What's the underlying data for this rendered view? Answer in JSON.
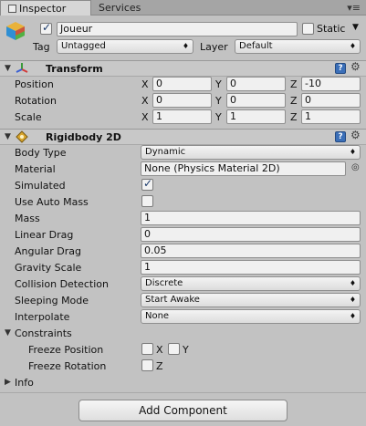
{
  "tabs": [
    {
      "label": "Inspector"
    },
    {
      "label": "Services"
    }
  ],
  "object": {
    "name": "Joueur",
    "active": true,
    "static_label": "Static",
    "static": false,
    "tag_label": "Tag",
    "tag": "Untagged",
    "layer_label": "Layer",
    "layer": "Default"
  },
  "transform": {
    "title": "Transform",
    "rows": [
      {
        "label": "Position",
        "x": "0",
        "y": "0",
        "z": "-10"
      },
      {
        "label": "Rotation",
        "x": "0",
        "y": "0",
        "z": "0"
      },
      {
        "label": "Scale",
        "x": "1",
        "y": "1",
        "z": "1"
      }
    ],
    "axis": {
      "x": "X",
      "y": "Y",
      "z": "Z"
    }
  },
  "rigidbody": {
    "title": "Rigidbody 2D",
    "body_type_label": "Body Type",
    "body_type": "Dynamic",
    "material_label": "Material",
    "material": "None (Physics Material 2D)",
    "simulated_label": "Simulated",
    "simulated": true,
    "auto_mass_label": "Use Auto Mass",
    "auto_mass": false,
    "mass_label": "Mass",
    "mass": "1",
    "linear_drag_label": "Linear Drag",
    "linear_drag": "0",
    "angular_drag_label": "Angular Drag",
    "angular_drag": "0.05",
    "gravity_scale_label": "Gravity Scale",
    "gravity_scale": "1",
    "collision_label": "Collision Detection",
    "collision": "Discrete",
    "sleeping_label": "Sleeping Mode",
    "sleeping": "Start Awake",
    "interpolate_label": "Interpolate",
    "interpolate": "None",
    "constraints_label": "Constraints",
    "freeze_position_label": "Freeze Position",
    "freeze_rotation_label": "Freeze Rotation",
    "x_label": "X",
    "y_label": "Y",
    "z_label": "Z",
    "info_label": "Info"
  },
  "add_component_label": "Add Component",
  "icons": {
    "help": "?",
    "gear": "⚙",
    "fold_open": "▼",
    "fold_closed": "▶",
    "dropdown": "♦",
    "menu": "▾≡"
  }
}
